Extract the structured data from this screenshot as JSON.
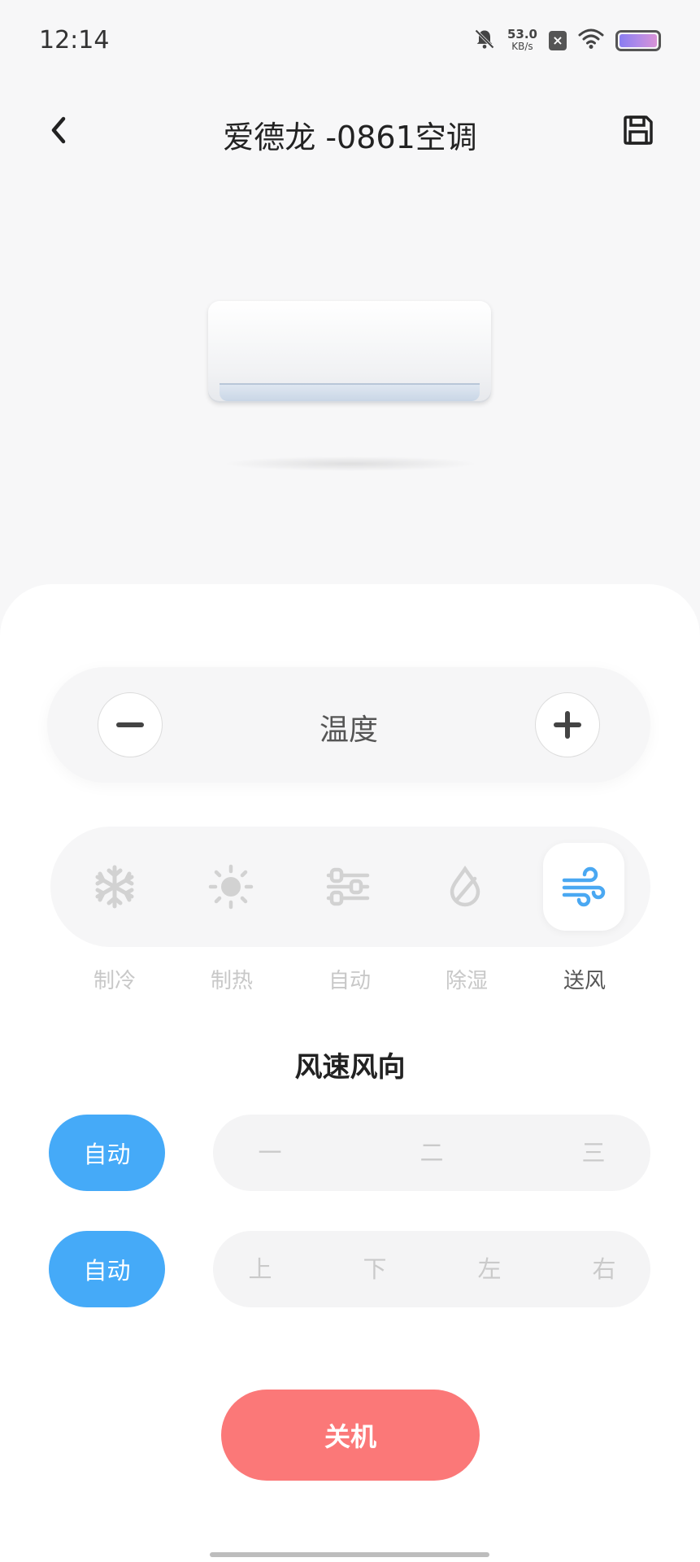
{
  "status_bar": {
    "time": "12:14",
    "net_speed": "53.0",
    "net_unit": "KB/s",
    "sim_label": "×",
    "icons": [
      "bell-muted-icon",
      "sim-blocked-icon",
      "wifi-icon",
      "battery-icon"
    ]
  },
  "header": {
    "title": "爱德龙 -0861空调",
    "back_icon": "chevron-left-icon",
    "save_icon": "save-icon"
  },
  "temperature": {
    "label": "温度",
    "minus_icon": "minus-icon",
    "plus_icon": "plus-icon"
  },
  "modes": {
    "items": [
      {
        "label": "制冷",
        "icon": "snowflake-icon",
        "active": false
      },
      {
        "label": "制热",
        "icon": "sun-icon",
        "active": false
      },
      {
        "label": "自动",
        "icon": "sliders-icon",
        "active": false
      },
      {
        "label": "除湿",
        "icon": "drop-icon",
        "active": false
      },
      {
        "label": "送风",
        "icon": "wind-icon",
        "active": true
      }
    ]
  },
  "fan": {
    "title": "风速风向",
    "speed_auto_label": "自动",
    "speed_options": [
      "一",
      "二",
      "三"
    ],
    "direction_auto_label": "自动",
    "direction_options": [
      "上",
      "下",
      "左",
      "右"
    ]
  },
  "power": {
    "label": "关机"
  },
  "colors": {
    "accent": "#45aaf8",
    "power": "#fb7878",
    "active_icon": "#4aa8f2",
    "inactive": "#cacaca"
  }
}
